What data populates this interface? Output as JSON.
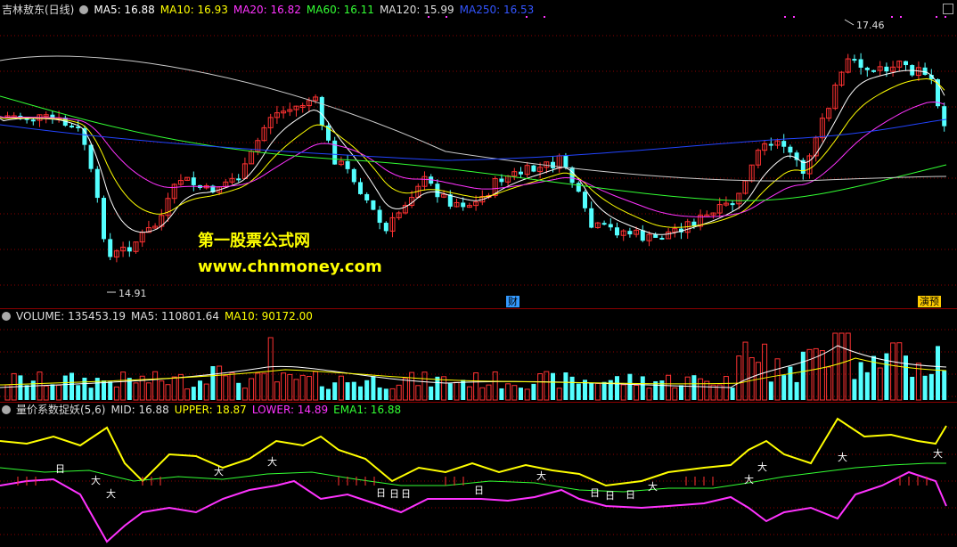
{
  "main_panel": {
    "title": "吉林敖东(日线)",
    "indicators": [
      {
        "label": "MA5: 16.88",
        "color": "#ffffff"
      },
      {
        "label": "MA10: 16.93",
        "color": "#ffff00"
      },
      {
        "label": "MA20: 16.82",
        "color": "#ff33ff"
      },
      {
        "label": "MA60: 16.11",
        "color": "#33ff33"
      },
      {
        "label": "MA120: 15.99",
        "color": "#dddddd"
      },
      {
        "label": "MA250: 16.53",
        "color": "#3355ff"
      }
    ],
    "high_label": "17.46",
    "low_label": "14.91",
    "cai_tag": "财",
    "yan_tag": "演预",
    "watermark_cn": "第一股票公式网",
    "watermark_url": "www.chnmoney.com"
  },
  "volume_panel": {
    "title": "VOLUME: 135453.19",
    "ma5": "MA5: 110801.64",
    "ma10": "MA10: 90172.00"
  },
  "indicator_panel": {
    "title": "量价系数捉妖(5,6)",
    "mid": "MID: 16.88",
    "upper": "UPPER: 18.87",
    "lower": "LOWER: 14.89",
    "ema1": "EMA1: 16.88",
    "marker_big": "大",
    "marker_sun": "日"
  },
  "colors": {
    "up": "#ff3232",
    "down": "#54ffff",
    "grid": "#8b0000"
  }
}
